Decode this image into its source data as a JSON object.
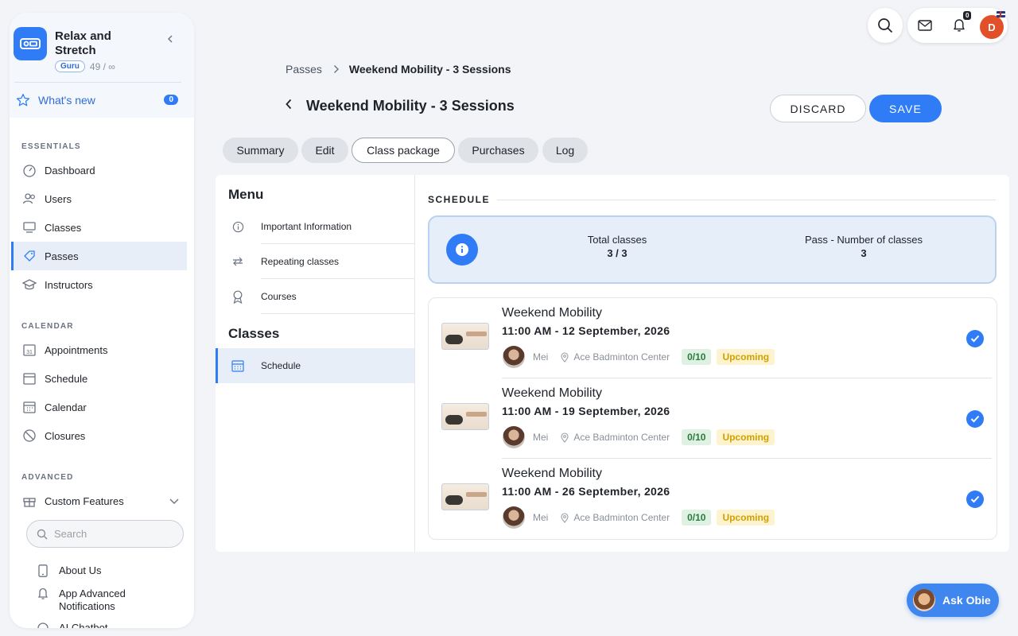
{
  "sidebar": {
    "brand": {
      "name": "Relax and Stretch",
      "badge": "Guru",
      "count": "49 / ∞"
    },
    "whats_new": {
      "label": "What's new",
      "count": "0"
    },
    "sections": {
      "essentials": "ESSENTIALS",
      "calendar": "CALENDAR",
      "advanced": "ADVANCED"
    },
    "essentials_items": [
      {
        "label": "Dashboard",
        "icon": "dashboard-icon"
      },
      {
        "label": "Users",
        "icon": "users-icon"
      },
      {
        "label": "Classes",
        "icon": "classes-icon"
      },
      {
        "label": "Passes",
        "icon": "passes-icon",
        "active": true
      },
      {
        "label": "Instructors",
        "icon": "instructors-icon"
      }
    ],
    "calendar_items": [
      {
        "label": "Appointments",
        "icon": "appointments-icon"
      },
      {
        "label": "Schedule",
        "icon": "schedule-icon"
      },
      {
        "label": "Calendar",
        "icon": "calendar-icon"
      },
      {
        "label": "Closures",
        "icon": "closures-icon"
      }
    ],
    "advanced_items": [
      {
        "label": "Custom Features",
        "icon": "gift-icon"
      }
    ],
    "search": {
      "placeholder": "Search"
    },
    "sub_items": [
      {
        "label": "About Us",
        "icon": "phone-icon"
      },
      {
        "label": "App Advanced Notifications",
        "icon": "bell-icon"
      },
      {
        "label": "AI Chatbot",
        "icon": "chat-icon"
      }
    ]
  },
  "topbar": {
    "notifications_count": "0",
    "avatar_initial": "D"
  },
  "breadcrumb": {
    "parent": "Passes",
    "current": "Weekend Mobility - 3 Sessions"
  },
  "page": {
    "title": "Weekend Mobility - 3 Sessions",
    "discard_label": "DISCARD",
    "save_label": "SAVE"
  },
  "tabs": [
    {
      "label": "Summary"
    },
    {
      "label": "Edit"
    },
    {
      "label": "Class package",
      "active": true
    },
    {
      "label": "Purchases"
    },
    {
      "label": "Log"
    }
  ],
  "left_menu": {
    "menu_heading": "Menu",
    "items": [
      {
        "label": "Important Information",
        "icon": "info-icon"
      },
      {
        "label": "Repeating classes",
        "icon": "repeat-icon"
      },
      {
        "label": "Courses",
        "icon": "award-icon"
      }
    ],
    "classes_heading": "Classes",
    "classes_items": [
      {
        "label": "Schedule",
        "icon": "calendar-grid-icon",
        "active": true
      }
    ]
  },
  "schedule": {
    "label": "SCHEDULE",
    "total_label": "Total classes",
    "total_value": "3 / 3",
    "pass_label": "Pass - Number of classes",
    "pass_value": "3",
    "classes": [
      {
        "title": "Weekend Mobility",
        "time": "11:00 AM - 12 September, 2026",
        "instructor": "Mei",
        "location": "Ace Badminton Center",
        "capacity": "0/10",
        "status": "Upcoming"
      },
      {
        "title": "Weekend Mobility",
        "time": "11:00 AM - 19 September, 2026",
        "instructor": "Mei",
        "location": "Ace Badminton Center",
        "capacity": "0/10",
        "status": "Upcoming"
      },
      {
        "title": "Weekend Mobility",
        "time": "11:00 AM - 26 September, 2026",
        "instructor": "Mei",
        "location": "Ace Badminton Center",
        "capacity": "0/10",
        "status": "Upcoming"
      }
    ]
  },
  "assistant": {
    "label": "Ask Obie"
  },
  "colors": {
    "accent": "#2f7cf6",
    "capacity_bg": "#dff1e3",
    "status_bg": "#fdf3cf"
  }
}
